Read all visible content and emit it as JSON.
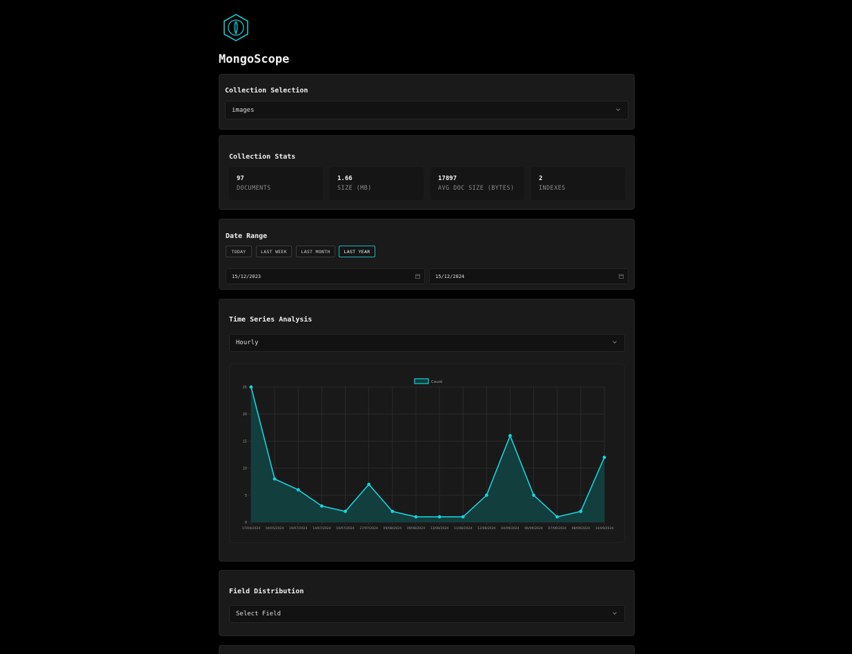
{
  "app": {
    "title": "MongoScope",
    "logo_icon": "hexagon-leaf-icon",
    "accent": "#00d8e0"
  },
  "collection_selection": {
    "title": "Collection Selection",
    "selected": "images"
  },
  "collection_stats": {
    "title": "Collection Stats",
    "items": [
      {
        "value": "97",
        "label": "DOCUMENTS"
      },
      {
        "value": "1.66",
        "label": "SIZE (MB)"
      },
      {
        "value": "17897",
        "label": "AVG DOC SIZE (BYTES)"
      },
      {
        "value": "2",
        "label": "INDEXES"
      }
    ]
  },
  "date_range": {
    "title": "Date Range",
    "buttons": [
      "TODAY",
      "LAST WEEK",
      "LAST MONTH",
      "LAST YEAR"
    ],
    "active": "LAST YEAR",
    "start": "15/12/2023",
    "end": "15/12/2024"
  },
  "time_series": {
    "title": "Time Series Analysis",
    "interval": "Hourly"
  },
  "chart_data": {
    "type": "area",
    "categories": [
      "17/04/2024",
      "04/05/2024",
      "16/07/2024",
      "14/07/2024",
      "16/07/2024",
      "27/07/2024",
      "09/08/2024",
      "09/08/2024",
      "13/08/2024",
      "11/08/2024",
      "12/08/2024",
      "04/09/2024",
      "06/09/2024",
      "07/09/2024",
      "08/09/2024",
      "14/09/2024"
    ],
    "series": [
      {
        "name": "Count",
        "values": [
          25,
          8,
          6,
          3,
          2,
          7,
          2,
          1,
          1,
          1,
          5,
          16,
          5,
          1,
          2,
          12
        ]
      }
    ],
    "ylim": [
      0,
      25
    ],
    "yticks": [
      0,
      5,
      10,
      15,
      20,
      25
    ],
    "grid": true,
    "legend": "top-center",
    "line_color": "#19d3dc",
    "fill_color": "#123e3e"
  },
  "field_distribution": {
    "title": "Field Distribution",
    "placeholder": "Select Field"
  }
}
